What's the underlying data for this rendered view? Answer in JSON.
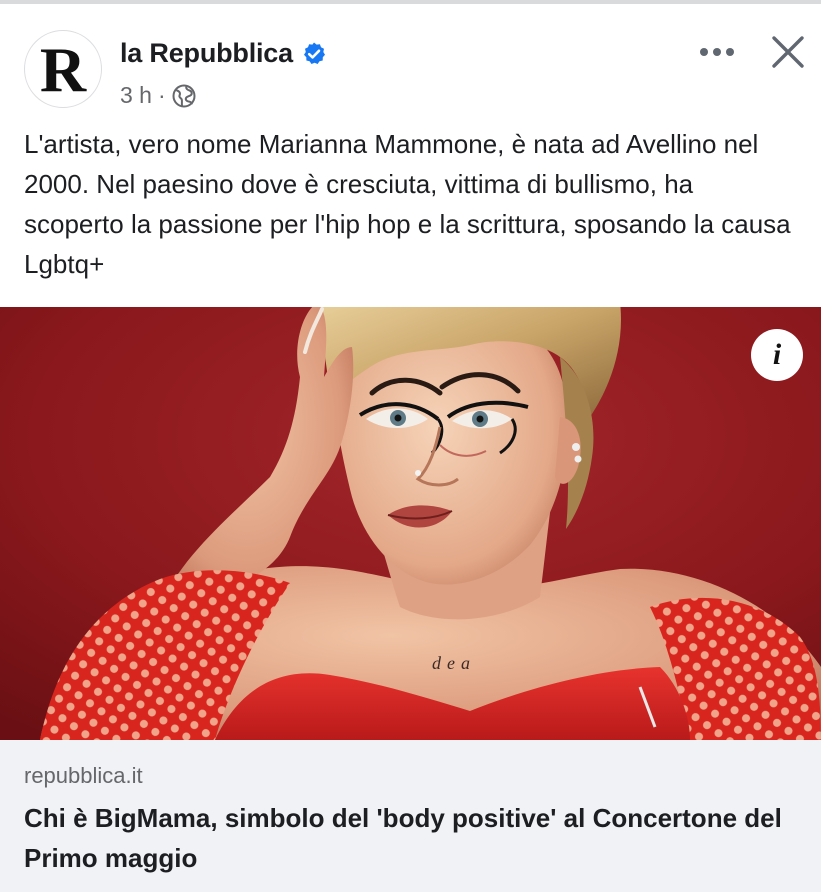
{
  "post": {
    "page_name": "la Repubblica",
    "avatar_letter": "R",
    "verified": true,
    "time": "3 h",
    "separator": "·",
    "audience_icon": "globe-icon",
    "text": "L'artista, vero nome Marianna Mammone, è nata ad Avellino nel 2000. Nel paesino dove è cresciuta, vittima di bullismo, ha scoperto la passione per l'hip hop e la scrittura, sposando la causa Lgbtq+"
  },
  "header_actions": {
    "more_icon": "more-horizontal-icon",
    "close_icon": "close-icon"
  },
  "media": {
    "overlay_icon": "info-icon",
    "info_glyph": "i",
    "tattoo_text": "dea"
  },
  "link_preview": {
    "domain": "repubblica.it",
    "title": "Chi è BigMama, simbolo del 'body positive' al Concertone del Primo maggio"
  },
  "colors": {
    "verified_blue": "#1877f2",
    "secondary_text": "#65676b",
    "preview_bg": "#f0f2f5",
    "photo_backdrop": "#8e1a1d"
  }
}
